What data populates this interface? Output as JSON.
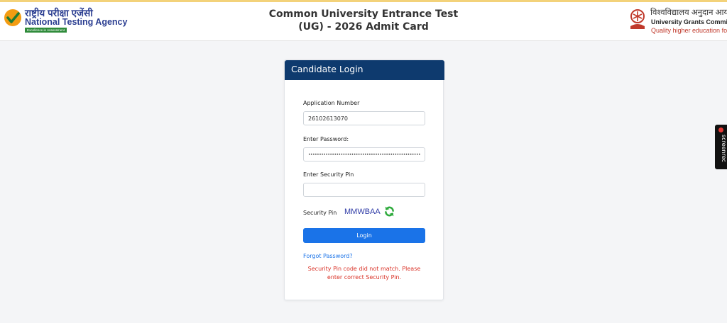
{
  "header": {
    "nta": {
      "hindi": "राष्ट्रीय परीक्षा एजेंसी",
      "name": "National Testing Agency",
      "tagline": "Excellence in Assessment"
    },
    "title_line1": "Common University Entrance Test",
    "title_line2": "(UG) - 2026 Admit Card",
    "ugc": {
      "hindi": "विश्वविद्यालय अनुदान आयोग",
      "name": "University Grants Commission",
      "tagline": "Quality higher education for all"
    }
  },
  "login": {
    "title": "Candidate Login",
    "application_label": "Application Number",
    "application_value": "26102613070",
    "password_label": "Enter Password:",
    "password_value": "••••••••••••••••••••••••••••••••••••••••••••••••••••",
    "pin_label": "Enter Security Pin",
    "pin_value": "",
    "captcha_label": "Security Pin",
    "captcha_text": "MMWBAA",
    "login_button": "Login",
    "forgot_link": "Forgot Password?",
    "error_message": "Security Pin code did not match. Please enter correct Security Pin."
  },
  "side_widget": {
    "label": "screenrec"
  },
  "colors": {
    "header_bar": "#0e3a6e",
    "button": "#1a73e8",
    "error": "#d93025",
    "captcha": "#2e3aa6",
    "refresh_icon": "#2eaa3c"
  },
  "icons": [
    "nta-logo-icon",
    "ugc-emblem-icon",
    "refresh-icon",
    "record-dot-icon"
  ]
}
